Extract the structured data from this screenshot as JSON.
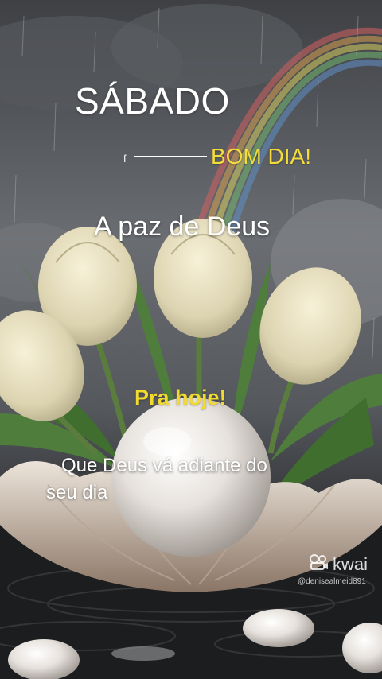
{
  "greeting": {
    "day": "SÁBADO",
    "mark": "f",
    "bom_dia": "BOM DIA!",
    "blessing_title": "A paz de Deus",
    "subtitle": "Pra hoje!",
    "message_line1": "Que Deus vá adiante do",
    "message_line2": "seu dia"
  },
  "watermark": {
    "brand": "kwai",
    "handle": "@denisealmeid891",
    "icon": "kwai-logo-icon"
  },
  "colors": {
    "accent_yellow": "#f2da2e",
    "text_white": "#ffffff",
    "background_gray": "#4a4d52"
  }
}
